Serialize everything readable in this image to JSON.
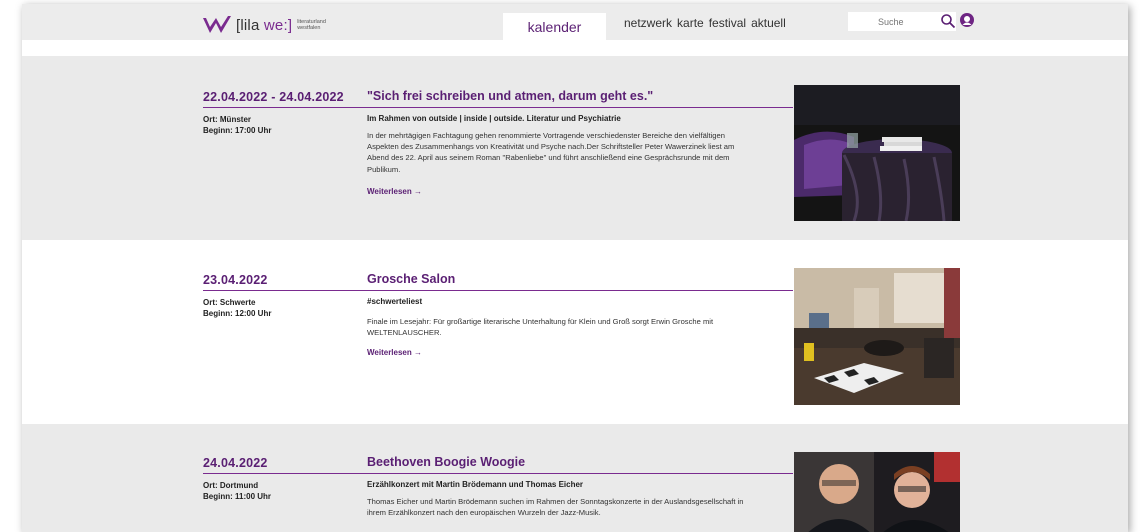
{
  "header": {
    "logo_text_1": "[lila ",
    "logo_text_2": "we:]",
    "logo_sub_1": "literaturland",
    "logo_sub_2": "westfalen",
    "nav_active": "kalender",
    "nav": [
      "netzwerk",
      "karte",
      "festival",
      "aktuell"
    ],
    "search_placeholder": "Suche"
  },
  "colors": {
    "accent": "#5a1f73",
    "gray_band": "#eaeaea"
  },
  "more_label": "Weiterlesen →",
  "events": [
    {
      "date": "22.04.2022 - 24.04.2022",
      "title": "\"Sich frei schreiben und atmen, darum geht es.\"",
      "ort": "Ort: Münster",
      "beginn": "Beginn: 17:00 Uhr",
      "subtitle": "Im Rahmen von outside | inside | outside. Literatur und Psychiatrie",
      "description": "In der mehrtägigen Fachtagung gehen renommierte Vortragende verschiedenster Bereiche den vielfältigen Aspekten des Zusammenhangs von Kreativität und Psyche nach.Der Schriftsteller Peter Wawerzinek liest am Abend des 22. April aus seinem Roman \"Rabenliebe\" und führt anschließend eine Gesprächsrunde mit dem Publikum."
    },
    {
      "date": "23.04.2022",
      "title": "Grosche Salon",
      "ort": "Ort: Schwerte",
      "beginn": "Beginn: 12:00 Uhr",
      "subtitle": "#schwerteliest",
      "description": "Finale im Lesejahr: Für großartige literarische Unterhaltung für Klein und Groß sorgt Erwin Grosche mit WELTENLAUSCHER."
    },
    {
      "date": "24.04.2022",
      "title": "Beethoven Boogie Woogie",
      "ort": "Ort: Dortmund",
      "beginn": "Beginn: 11:00 Uhr",
      "subtitle": "Erzählkonzert mit Martin Brödemann und Thomas Eicher",
      "description": "Thomas Eicher und Martin Brödemann suchen im Rahmen der Sonntagskonzerte in der Auslandsgesellschaft in ihrem Erzählkonzert nach den europäischen Wurzeln der Jazz-Musik."
    }
  ]
}
